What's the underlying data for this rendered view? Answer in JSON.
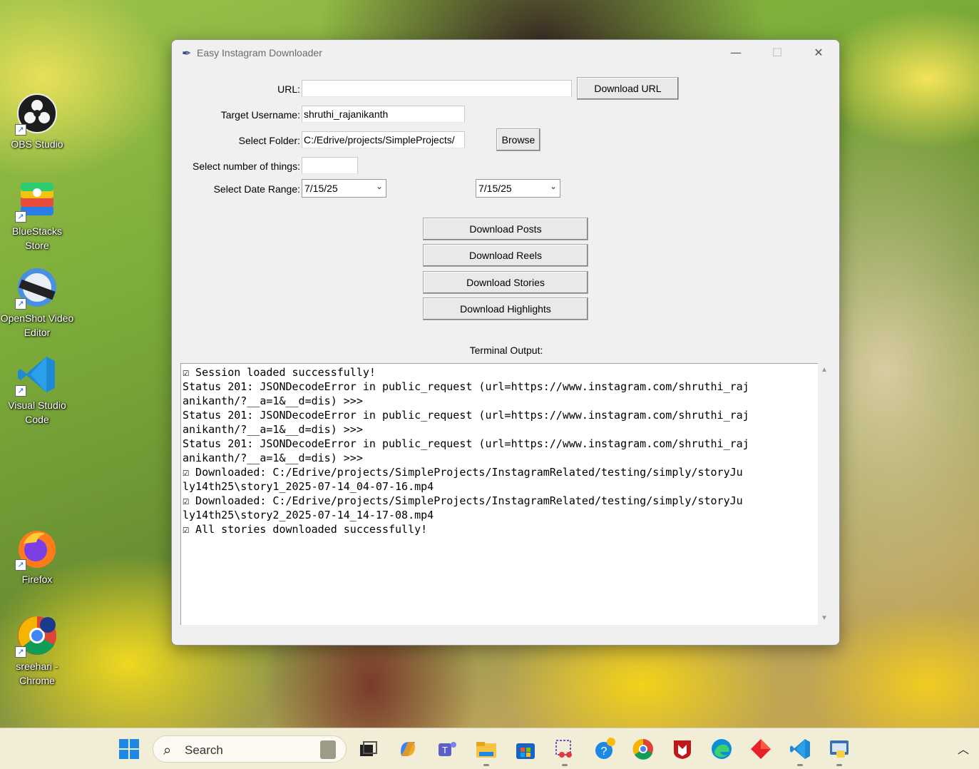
{
  "desktop": {
    "icons": [
      {
        "label": "OBS Studio",
        "icon": "obs-icon"
      },
      {
        "label": "BlueStacks Store",
        "icon": "bluestacks-icon"
      },
      {
        "label": "OpenShot Video Editor",
        "icon": "openshot-icon"
      },
      {
        "label": "Visual Studio Code",
        "icon": "vscode-icon"
      },
      {
        "label": "Firefox",
        "icon": "firefox-icon"
      },
      {
        "label": "sreehari - Chrome",
        "icon": "chrome-icon"
      }
    ]
  },
  "window": {
    "title": "Easy Instagram Downloader",
    "controls": {
      "minimize": "—",
      "maximize": "☐",
      "close": "✕"
    }
  },
  "form": {
    "url_label": "URL:",
    "url_value": "",
    "download_url_button": "Download URL",
    "username_label": "Target Username:",
    "username_value": "shruthi_rajanikanth",
    "folder_label": "Select Folder:",
    "folder_value": "C:/Edrive/projects/SimpleProjects/",
    "browse_button": "Browse",
    "count_label": "Select number of things:",
    "count_value": "",
    "date_range_label": "Select Date Range:",
    "date_start": "7/15/25",
    "date_end": "7/15/25"
  },
  "actions": {
    "download_posts": "Download Posts",
    "download_reels": "Download Reels",
    "download_stories": "Download Stories",
    "download_highlights": "Download Highlights"
  },
  "terminal": {
    "label": "Terminal Output:",
    "lines": [
      "☑ Session loaded successfully!",
      "Status 201: JSONDecodeError in public_request (url=https://www.instagram.com/shruthi_raj",
      "anikanth/?__a=1&__d=dis) >>>",
      "Status 201: JSONDecodeError in public_request (url=https://www.instagram.com/shruthi_raj",
      "anikanth/?__a=1&__d=dis) >>>",
      "Status 201: JSONDecodeError in public_request (url=https://www.instagram.com/shruthi_raj",
      "anikanth/?__a=1&__d=dis) >>>",
      "☑ Downloaded: C:/Edrive/projects/SimpleProjects/InstagramRelated/testing/simply/storyJu",
      "ly14th25\\story1_2025-07-14_04-07-16.mp4",
      "☑ Downloaded: C:/Edrive/projects/SimpleProjects/InstagramRelated/testing/simply/storyJu",
      "ly14th25\\story2_2025-07-14_14-17-08.mp4",
      "☑ All stories downloaded successfully!"
    ]
  },
  "taskbar": {
    "search_placeholder": "Search",
    "apps": [
      "start-icon",
      "task-view-icon",
      "copilot-icon",
      "teams-icon",
      "file-explorer-icon",
      "store-icon",
      "snipping-tool-icon",
      "help-icon",
      "chrome-icon",
      "mcafee-icon",
      "edge-icon",
      "app-diamond-icon",
      "vscode-icon",
      "python-icon"
    ]
  }
}
